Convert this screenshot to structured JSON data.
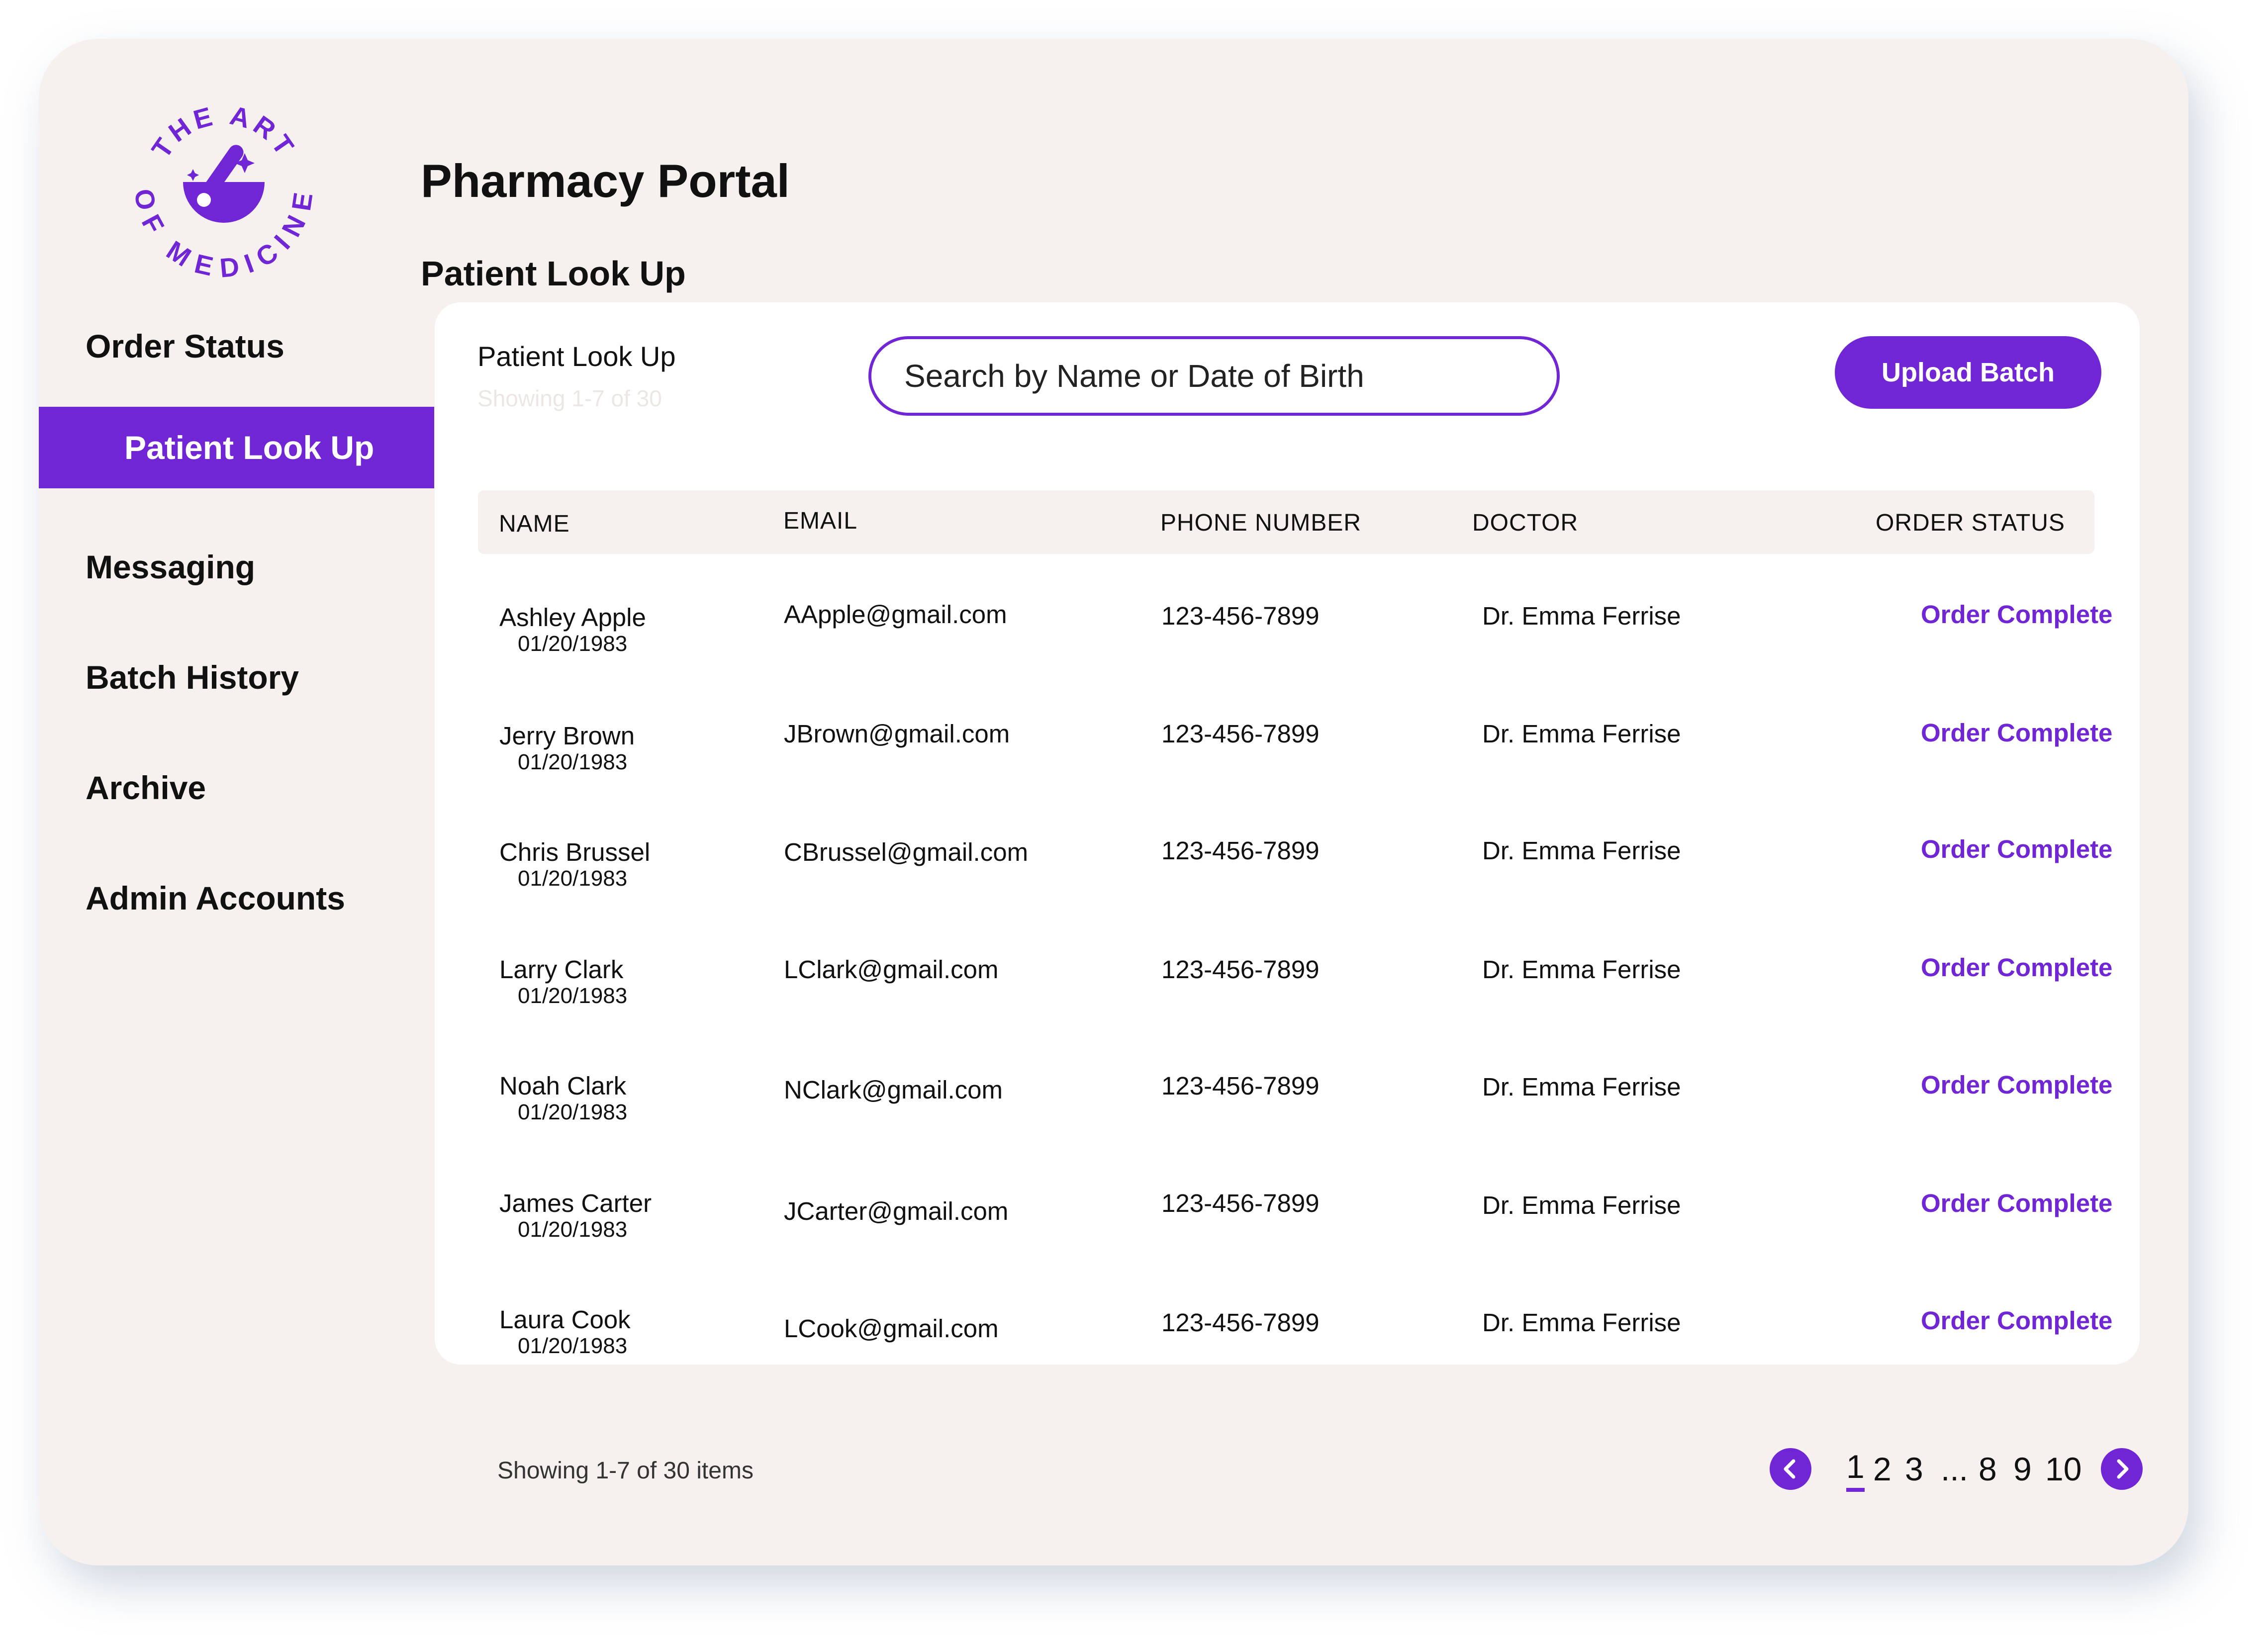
{
  "brand": {
    "logo_text": "THE ART OF MEDICINE",
    "logo_icon": "mortar-and-pestle-icon",
    "accent_color": "#7126d5"
  },
  "header": {
    "title": "Pharmacy Portal",
    "subtitle": "Patient Look Up"
  },
  "sidebar": {
    "items": [
      {
        "label": "Order Status",
        "active": false
      },
      {
        "label": "Patient Look Up",
        "active": true
      },
      {
        "label": "Messaging",
        "active": false
      },
      {
        "label": "Batch History",
        "active": false
      },
      {
        "label": "Archive",
        "active": false
      },
      {
        "label": "Admin Accounts",
        "active": false
      }
    ]
  },
  "card": {
    "title": "Patient Look Up",
    "showing": "Showing 1-7 of 30",
    "search_placeholder": "Search by Name or Date of Birth",
    "upload_label": "Upload Batch"
  },
  "table": {
    "columns": [
      "NAME",
      "EMAIL",
      "PHONE NUMBER",
      "DOCTOR",
      "ORDER STATUS"
    ],
    "rows": [
      {
        "name": "Ashley Apple",
        "dob": "01/20/1983",
        "email": "AApple@gmail.com",
        "phone": "123-456-7899",
        "doctor": "Dr. Emma Ferrise",
        "status": "Order Complete"
      },
      {
        "name": "Jerry  Brown",
        "dob": "01/20/1983",
        "email": "JBrown@gmail.com",
        "phone": "123-456-7899",
        "doctor": "Dr. Emma Ferrise",
        "status": "Order Complete"
      },
      {
        "name": "Chris Brussel",
        "dob": "01/20/1983",
        "email": "CBrussel@gmail.com",
        "phone": "123-456-7899",
        "doctor": "Dr. Emma Ferrise",
        "status": "Order Complete"
      },
      {
        "name": "Larry Clark",
        "dob": "01/20/1983",
        "email": "LClark@gmail.com",
        "phone": "123-456-7899",
        "doctor": "Dr. Emma Ferrise",
        "status": "Order Complete"
      },
      {
        "name": "Noah Clark",
        "dob": "01/20/1983",
        "email": "NClark@gmail.com",
        "phone": "123-456-7899",
        "doctor": "Dr. Emma Ferrise",
        "status": "Order Complete"
      },
      {
        "name": "James Carter",
        "dob": "01/20/1983",
        "email": "JCarter@gmail.com",
        "phone": "123-456-7899",
        "doctor": "Dr. Emma Ferrise",
        "status": "Order Complete"
      },
      {
        "name": "Laura Cook",
        "dob": "01/20/1983",
        "email": "LCook@gmail.com",
        "phone": "123-456-7899",
        "doctor": "Dr. Emma Ferrise",
        "status": "Order Complete"
      }
    ]
  },
  "footer": {
    "showing": "Showing 1-7 of 30 items",
    "prev_icon": "chevron-left-icon",
    "next_icon": "chevron-right-icon",
    "pages": [
      "1",
      "2",
      "3",
      "...",
      "8",
      "9",
      "10"
    ],
    "current_page": "1"
  }
}
